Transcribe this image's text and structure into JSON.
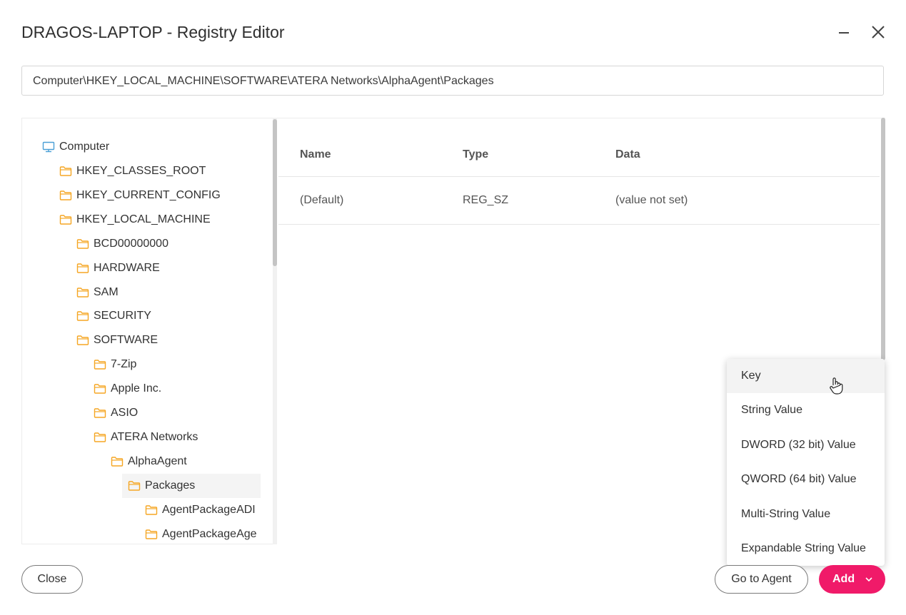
{
  "window": {
    "title": "DRAGOS-LAPTOP - Registry Editor",
    "minimize_icon": "minimize-icon",
    "close_icon": "close-icon"
  },
  "path": {
    "value": "Computer\\HKEY_LOCAL_MACHINE\\SOFTWARE\\ATERA Networks\\AlphaAgent\\Packages"
  },
  "tree": {
    "root": {
      "label": "Computer",
      "icon": "computer-icon"
    },
    "items": [
      {
        "label": "HKEY_CLASSES_ROOT",
        "level": 1
      },
      {
        "label": "HKEY_CURRENT_CONFIG",
        "level": 1
      },
      {
        "label": "HKEY_LOCAL_MACHINE",
        "level": 1
      },
      {
        "label": "BCD00000000",
        "level": 2
      },
      {
        "label": "HARDWARE",
        "level": 2
      },
      {
        "label": "SAM",
        "level": 2
      },
      {
        "label": "SECURITY",
        "level": 2
      },
      {
        "label": "SOFTWARE",
        "level": 2
      },
      {
        "label": "7-Zip",
        "level": 3
      },
      {
        "label": "Apple Inc.",
        "level": 3
      },
      {
        "label": "ASIO",
        "level": 3
      },
      {
        "label": "ATERA Networks",
        "level": 3
      },
      {
        "label": "AlphaAgent",
        "level": 4
      },
      {
        "label": "Packages",
        "level": 5,
        "selected": true
      },
      {
        "label": "AgentPackageADI",
        "level": 6
      },
      {
        "label": "AgentPackageAge",
        "level": 6
      }
    ],
    "folder_icon": "folder-icon",
    "folder_color": "#f5a623"
  },
  "table": {
    "columns": [
      "Name",
      "Type",
      "Data"
    ],
    "rows": [
      [
        "(Default)",
        "REG_SZ",
        "(value not set)"
      ]
    ]
  },
  "add_menu": {
    "items": [
      "Key",
      "String Value",
      "DWORD (32 bit) Value",
      "QWORD (64 bit) Value",
      "Multi-String Value",
      "Expandable String Value"
    ],
    "hovered": "Key"
  },
  "footer": {
    "close_label": "Close",
    "go_to_agent_label": "Go to Agent",
    "add_label": "Add",
    "add_color": "#f01a69"
  }
}
